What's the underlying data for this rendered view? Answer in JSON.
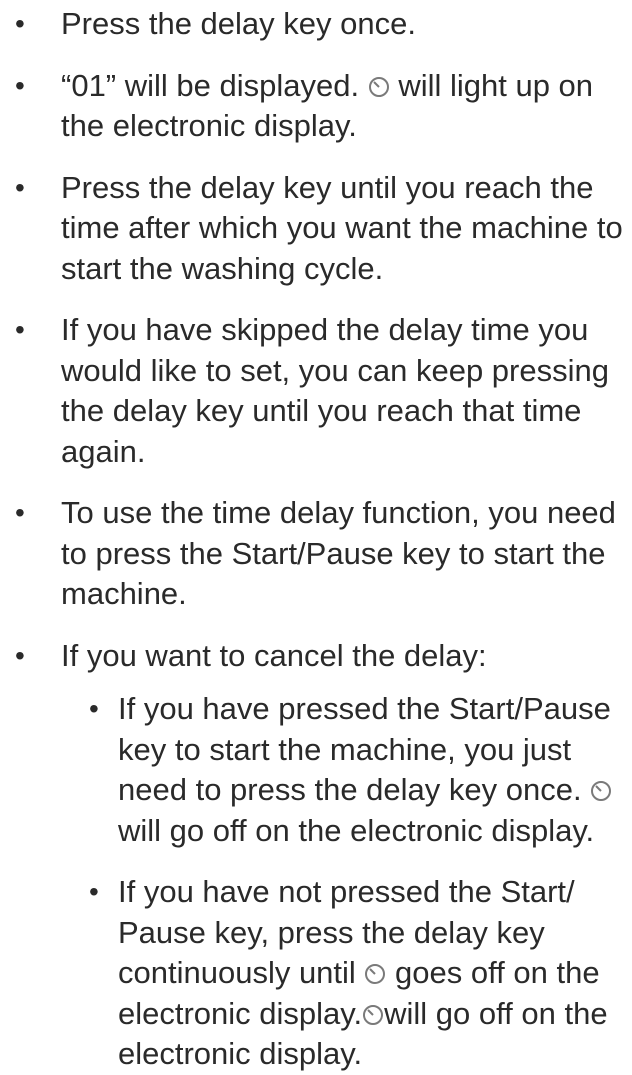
{
  "items": [
    {
      "text": "Press the delay key once."
    },
    {
      "before": "“01” will be displayed. ",
      "icon": "delay-clock-icon",
      "after": " will light up on the electronic display."
    },
    {
      "text": "Press the delay key until you reach the time after which you want the machine to start the washing cycle."
    },
    {
      "text": "If you have skipped the delay time you would like to set, you can keep pressing the delay key until you reach that time again."
    },
    {
      "text": "To use the time delay function, you need to press the Start/Pause key to start the machine."
    },
    {
      "text": "If you want to cancel the delay:"
    }
  ],
  "subitems": [
    {
      "before": "If you have pressed the Start/Pause key to start the machine, you just need to press the delay key once. ",
      "icon": "delay-clock-icon",
      "after": " will go off on the electronic display."
    },
    {
      "before": "If you have not pressed the Start/ Pause key, press the delay key continuously until ",
      "icon": "delay-clock-icon",
      "middle": " goes off on the electronic display.",
      "icon2": "delay-clock-icon",
      "after": "will go off on the electronic display."
    }
  ],
  "bullet_char": "•"
}
